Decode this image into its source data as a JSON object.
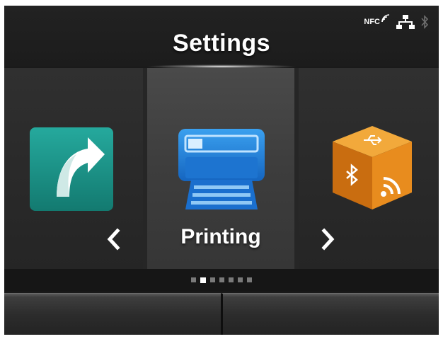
{
  "header": {
    "title": "Settings",
    "status": {
      "nfc_label": "NFC",
      "icons": [
        "nfc-icon",
        "network-icon",
        "bluetooth-icon"
      ]
    }
  },
  "carousel": {
    "prev_item": {
      "icon": "shortcut-arrow-icon",
      "color": "#1e9a8f"
    },
    "current_item": {
      "label": "Printing",
      "icon": "printer-icon",
      "color": "#1e7fd6"
    },
    "next_item": {
      "icon": "interface-cube-icon",
      "color": "#e0901f"
    },
    "nav": {
      "prev_icon": "chevron-left-icon",
      "next_icon": "chevron-right-icon"
    }
  },
  "pager": {
    "total_pages": 7,
    "current_page": 2
  },
  "softkeys": {
    "left_label": "",
    "right_label": ""
  },
  "colors": {
    "background": "#1a1a1a",
    "panel_active": "#3d3d3d",
    "text": "#ffffff"
  }
}
